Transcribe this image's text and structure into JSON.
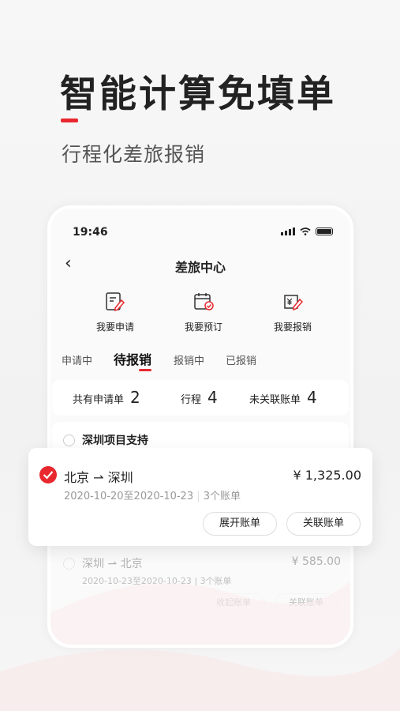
{
  "hero": {
    "title": "智能计算免填单",
    "subtitle": "行程化差旅报销",
    "accent": "#e8282e"
  },
  "status_bar": {
    "time": "19:46"
  },
  "nav": {
    "title": "差旅中心"
  },
  "actions": [
    {
      "label": "我要申请",
      "icon": "apply-form-icon"
    },
    {
      "label": "我要预订",
      "icon": "calendar-booking-icon"
    },
    {
      "label": "我要报销",
      "icon": "reimburse-icon"
    }
  ],
  "tabs": [
    {
      "label": "申请中",
      "active": false
    },
    {
      "label": "待报销",
      "active": true
    },
    {
      "label": "报销中",
      "active": false
    },
    {
      "label": "已报销",
      "active": false
    }
  ],
  "summary": {
    "applications_label": "共有申请单",
    "applications_count": "2",
    "trips_label": "行程",
    "trips_count": "4",
    "unlinked_label": "未关联账单",
    "unlinked_count": "4"
  },
  "project": {
    "name": "深圳项目支持"
  },
  "selected_trip": {
    "from": "北京",
    "arrow": "⇀",
    "to": "深圳",
    "price": "¥ 1,325.00",
    "dates": "2020-10-20至2020-10-23",
    "bills": "3个账单",
    "expand_label": "展开账单",
    "link_label": "关联账单"
  },
  "faded_trip": {
    "from": "深圳",
    "arrow": "⇀",
    "to": "北京",
    "price": "¥ 585.00",
    "dates": "2020-10-23至2020-10-23",
    "bills": "3个账单",
    "collapse_label": "收起账单",
    "link_label": "关联账单"
  }
}
